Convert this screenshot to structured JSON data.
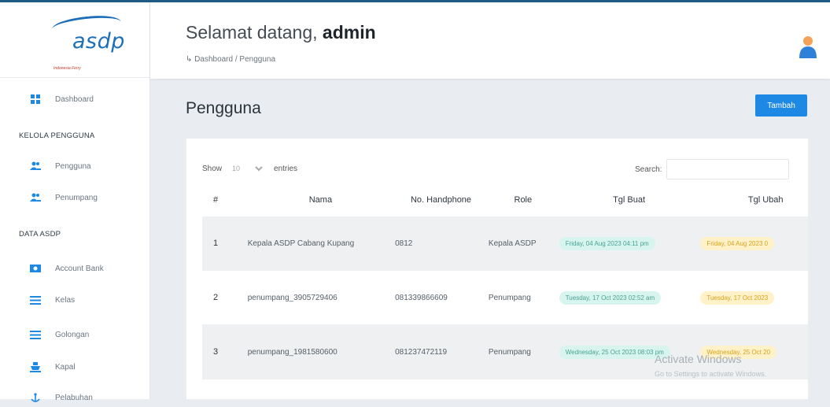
{
  "logo": {
    "text": "asdp",
    "subtitle": "Indonesia Ferry"
  },
  "sidebar": {
    "dashboard": "Dashboard",
    "section_kelola": "KELOLA PENGGUNA",
    "pengguna": "Pengguna",
    "penumpang": "Penumpang",
    "section_data": "DATA ASDP",
    "account_bank": "Account Bank",
    "kelas": "Kelas",
    "golongan": "Golongan",
    "kapal": "Kapal",
    "pelabuhan": "Pelabuhan"
  },
  "header": {
    "welcome": "Selamat datang,",
    "username": "admin",
    "breadcrumb": "↳ Dashboard / Pengguna"
  },
  "page": {
    "title": "Pengguna",
    "add_button": "Tambah"
  },
  "table_controls": {
    "show_label": "Show",
    "entries_value": "10",
    "entries_label": "entries",
    "search_label": "Search:"
  },
  "table": {
    "headers": [
      "#",
      "Nama",
      "No. Handphone",
      "Role",
      "Tgl Buat",
      "Tgl Ubah"
    ],
    "rows": [
      {
        "no": "1",
        "nama": "Kepala ASDP Cabang Kupang",
        "hp": "0812",
        "role": "Kepala ASDP",
        "buat": "Friday, 04 Aug 2023 04:11 pm",
        "ubah": "Friday, 04 Aug 2023 0"
      },
      {
        "no": "2",
        "nama": "penumpang_3905729406",
        "hp": "081339866609",
        "role": "Penumpang",
        "buat": "Tuesday, 17 Oct 2023 02:52 am",
        "ubah": "Tuesday, 17 Oct 2023"
      },
      {
        "no": "3",
        "nama": "penumpang_1981580600",
        "hp": "081237472119",
        "role": "Penumpang",
        "buat": "Wednesday, 25 Oct 2023 08:03 pm",
        "ubah": "Wednesday, 25 Oct 20"
      }
    ]
  },
  "watermark": {
    "title": "Activate Windows",
    "subtitle": "Go to Settings to activate Windows."
  },
  "colors": {
    "primary": "#1e88e5",
    "brand": "#1c6fb8",
    "tag_green": "#d7f4ee",
    "tag_yellow": "#fff1c8"
  }
}
